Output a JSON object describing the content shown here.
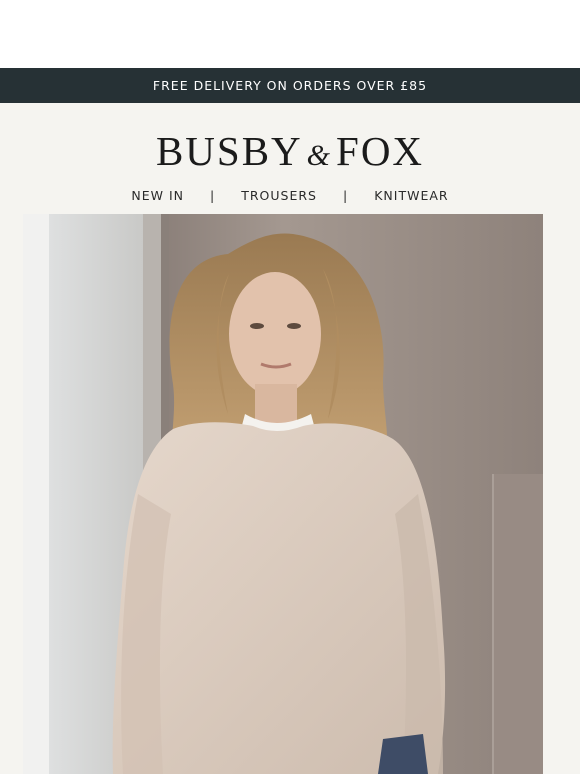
{
  "promo": {
    "text": "FREE DELIVERY ON ORDERS OVER £85"
  },
  "brand": {
    "part1": "BUSBY",
    "amp": "&",
    "part2": "FOX"
  },
  "nav": {
    "items": [
      {
        "label": "NEW IN"
      },
      {
        "label": "TROUSERS"
      },
      {
        "label": "KNITWEAR"
      }
    ],
    "separator": "|"
  },
  "hero": {
    "subject": "woman-in-knit-jumper"
  },
  "colors": {
    "promo_bg": "#263135",
    "header_bg": "#f5f4f0",
    "jumper": "#dcccbf",
    "wall": "#9c8e86"
  }
}
